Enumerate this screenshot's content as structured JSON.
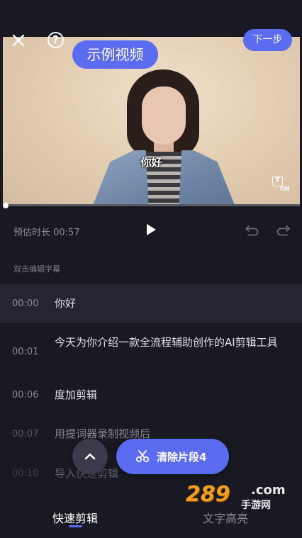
{
  "topbar": {
    "close_icon": "close-icon",
    "help_symbol": "?",
    "example_badge": "示例视频",
    "next_label": "下一步"
  },
  "video": {
    "subtitle_overlay": "你好",
    "ton_box": "T",
    "ton_label": "ON",
    "progress_fraction": 0.0
  },
  "playback": {
    "duration_text": "预估时长 00:57",
    "play_icon": "play-icon",
    "undo_icon": "undo-icon",
    "redo_icon": "redo-icon"
  },
  "hint": "双击编辑字幕",
  "subtitles": [
    {
      "time": "00:00",
      "text": "你好"
    },
    {
      "time": "00:01",
      "text": "今天为你介绍一款全流程辅助创作的AI剪辑工具"
    },
    {
      "time": "00:06",
      "text": "度加剪辑"
    },
    {
      "time": "00:07",
      "text": "用提词器录制视频后"
    },
    {
      "time": "00:10",
      "text": "导入快速剪辑"
    }
  ],
  "actions": {
    "collapse_icon": "chevron-up-icon",
    "clear_label": "清除片段4",
    "clear_icon": "scissors-icon"
  },
  "tabs": {
    "quick": "快速剪辑",
    "highlight": "文字高亮"
  },
  "watermark": {
    "number": "289",
    "com": ".com",
    "sub": "手游网"
  },
  "colors": {
    "background": "#191924",
    "accent": "#5b6cf0",
    "active_row": "#252532"
  }
}
